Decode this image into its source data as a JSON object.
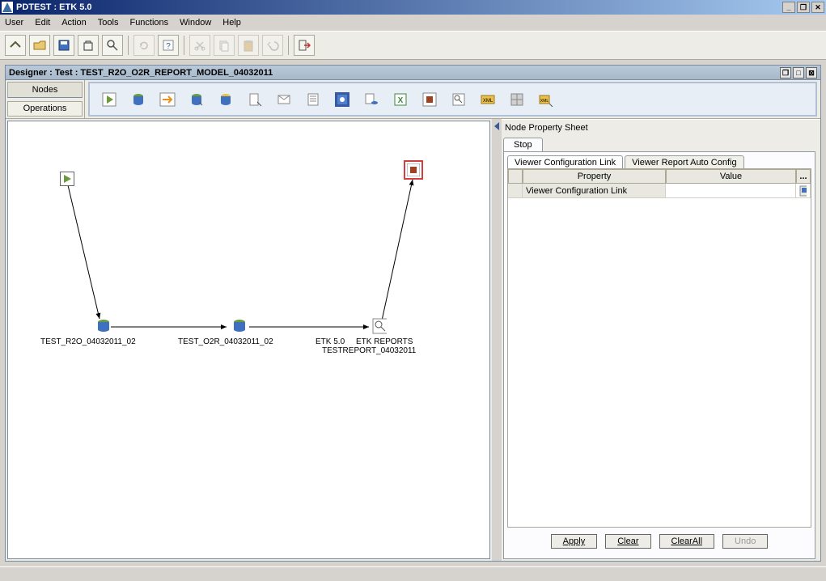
{
  "app_title": "PDTEST : ETK 5.0",
  "menu": [
    "User",
    "Edit",
    "Action",
    "Tools",
    "Functions",
    "Window",
    "Help"
  ],
  "designer_title": "Designer : Test : TEST_R2O_O2R_REPORT_MODEL_04032011",
  "palette_tabs": {
    "nodes": "Nodes",
    "operations": "Operations"
  },
  "canvas_nodes": {
    "n1_label": "TEST_R2O_04032011_02",
    "n2_label": "TEST_O2R_04032011_02",
    "n3_label": "ETK 5.0",
    "n4_label1": "ETK REPORTS",
    "n4_label2": "TESTREPORT_04032011"
  },
  "prop_panel": {
    "title": "Node Property Sheet",
    "tab": "Stop",
    "subtab1": "Viewer Configuration Link",
    "subtab2": "Viewer Report Auto Config",
    "header_property": "Property",
    "header_value": "Value",
    "header_ext": "...",
    "row1_prop": "Viewer Configuration Link",
    "row1_val": "",
    "buttons": {
      "apply": "Apply",
      "clear": "Clear",
      "clearall": "ClearAll",
      "undo": "Undo"
    }
  }
}
